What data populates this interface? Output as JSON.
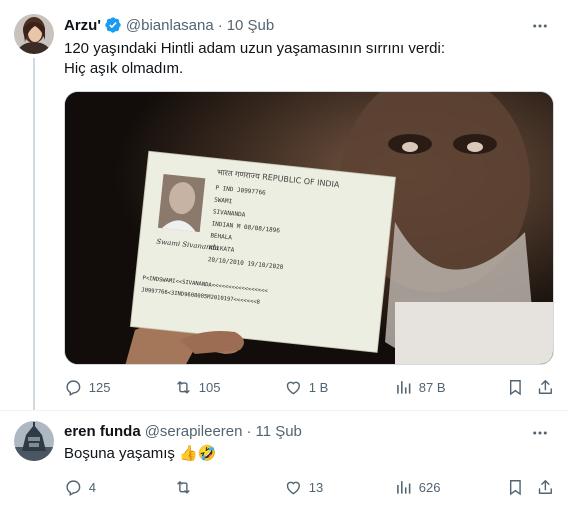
{
  "tweet": {
    "author_name": "Arzu'",
    "handle": "@bianlasana",
    "separator": "·",
    "date": "10 Şub",
    "text_lines": [
      "120 yaşındaki Hintli adam uzun yaşamasının sırrını verdi:",
      "Hiç aşık olmadım."
    ],
    "stats": {
      "replies": "125",
      "retweets": "105",
      "likes": "1 B",
      "views": "87 B"
    },
    "media_text": {
      "header": "भारत गणराज्य REPUBLIC OF INDIA",
      "type_label": "Type",
      "type": "P",
      "country_code": "IND",
      "passport_no": "J0997766",
      "surname": "SWAMI",
      "given_name": "SIVANANDA",
      "nationality": "INDIAN",
      "sex": "M",
      "dob": "08/08/1896",
      "place_of_birth": "BEHALA",
      "place_of_issue": "KOLKATA",
      "date_of_issue": "20/10/2010",
      "date_of_expiry": "19/10/2020",
      "signature": "Swami Sivananda",
      "mrz1": "P<INDSWAMI<<SIVANANDA<<<<<<<<<<<<<<<<<<<<<<<<",
      "mrz2": "J0997766<3IND9608085M2010197<<<<<<<<<<<<<<<8"
    },
    "colors": {
      "verified": "#1d9bf0",
      "muted": "#536471"
    }
  },
  "reply": {
    "author_name": "eren funda",
    "handle": "@serapileeren",
    "separator": "·",
    "date": "11 Şub",
    "text": "Boşuna yaşamış 👍🤣",
    "stats": {
      "replies": "4",
      "retweets": "",
      "likes": "13",
      "views": "626"
    }
  }
}
